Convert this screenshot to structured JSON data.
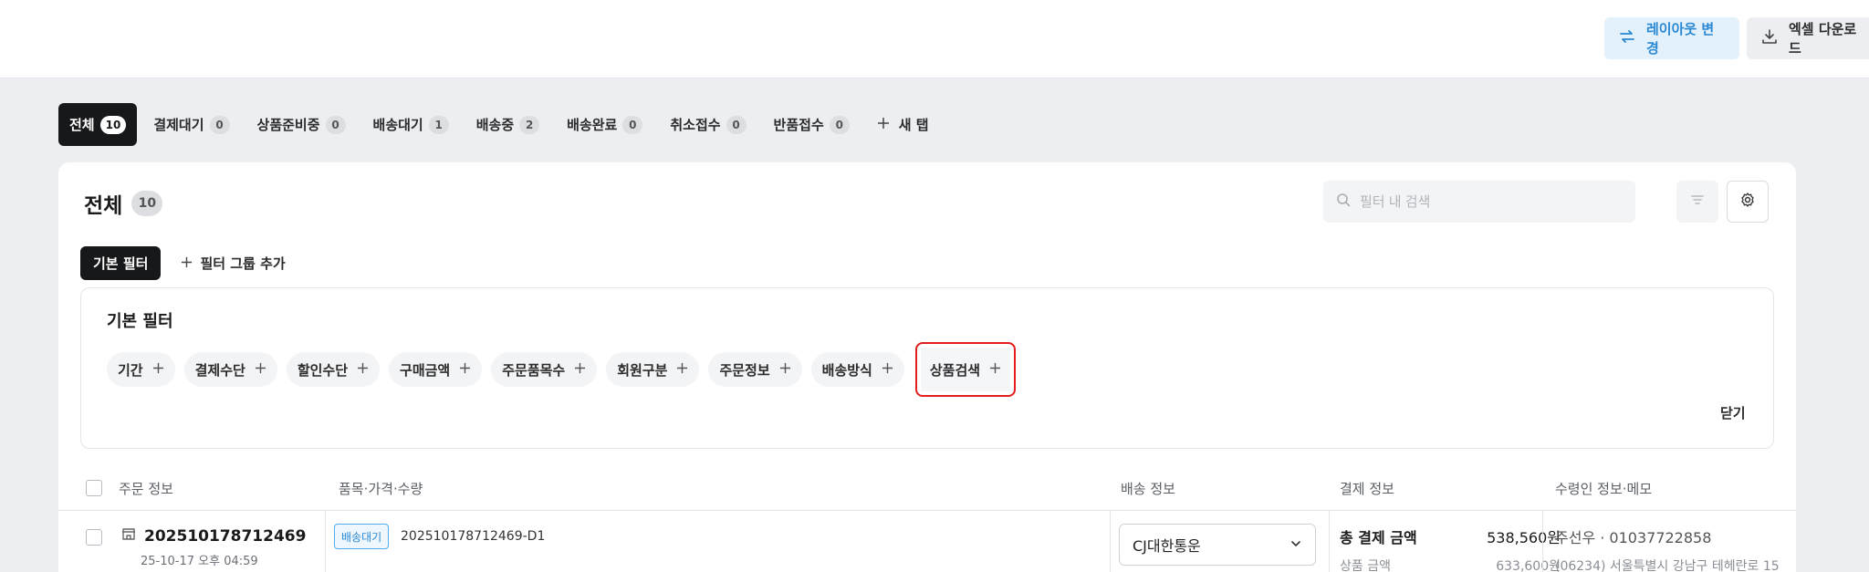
{
  "toolbar": {
    "layout_label": "레이아웃 변경",
    "excel_label": "엑셀 다운로드"
  },
  "tabs": [
    {
      "label": "전체",
      "count": "10"
    },
    {
      "label": "결제대기",
      "count": "0"
    },
    {
      "label": "상품준비중",
      "count": "0"
    },
    {
      "label": "배송대기",
      "count": "1"
    },
    {
      "label": "배송중",
      "count": "2"
    },
    {
      "label": "배송완료",
      "count": "0"
    },
    {
      "label": "취소접수",
      "count": "0"
    },
    {
      "label": "반품접수",
      "count": "0"
    }
  ],
  "new_tab_label": "새 탭",
  "panel": {
    "title": "전체",
    "count": "10",
    "search_placeholder": "필터 내 검색"
  },
  "filter_groups": {
    "active_label": "기본 필터",
    "add_label": "필터 그룹 추가"
  },
  "filter_panel": {
    "title": "기본 필터",
    "chips": [
      "기간",
      "결제수단",
      "할인수단",
      "구매금액",
      "주문품목수",
      "회원구분",
      "주문정보",
      "배송방식",
      "상품검색"
    ],
    "close_label": "닫기"
  },
  "table": {
    "headers": [
      "주문 정보",
      "품목·가격·수량",
      "배송 정보",
      "결제 정보",
      "수령인 정보·메모"
    ],
    "rows": [
      {
        "order_id": "202510178712469",
        "date": "25-10-17 오후 04:59",
        "status_badge": "배송대기",
        "sub_order_id": "202510178712469-D1",
        "carrier": "CJ대한통운",
        "total_label": "총 결제 금액",
        "total_value": "538,560원",
        "product_label": "상품 금액",
        "product_value": "633,600원",
        "recipient": "주선우 · 01037722858",
        "address": "(06234) 서울특별시 강남구 테헤란로 15"
      }
    ]
  }
}
